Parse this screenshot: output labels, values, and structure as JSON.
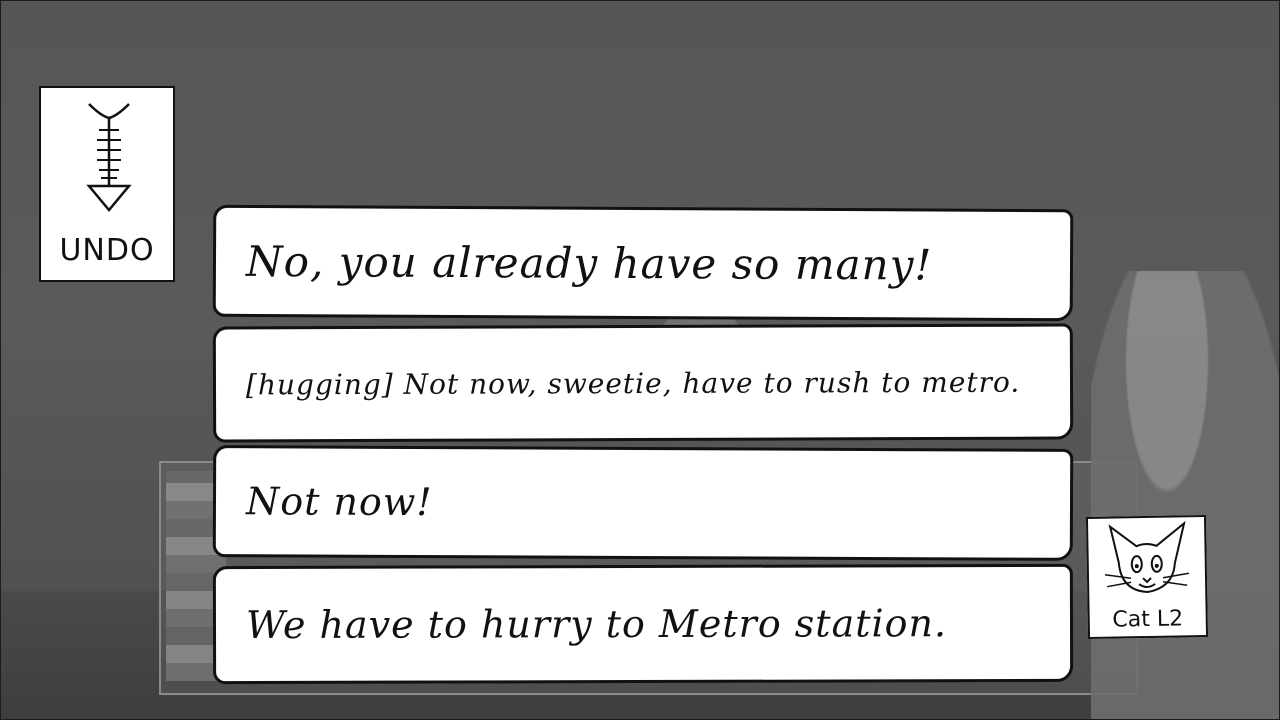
{
  "undo": {
    "label": "UNDO",
    "icon": "fishbone-arrow-icon"
  },
  "options": [
    {
      "text": "No, you already have so many!"
    },
    {
      "text": "[hugging] Not now, sweetie, have to rush to metro."
    },
    {
      "text": "Not now!"
    },
    {
      "text": "We have to hurry to Metro station."
    }
  ],
  "character": {
    "label": "Cat L2",
    "icon": "cat-face-icon"
  },
  "colors": {
    "card_bg": "#ffffff",
    "ink": "#111111",
    "scene_bg": "#565656"
  }
}
